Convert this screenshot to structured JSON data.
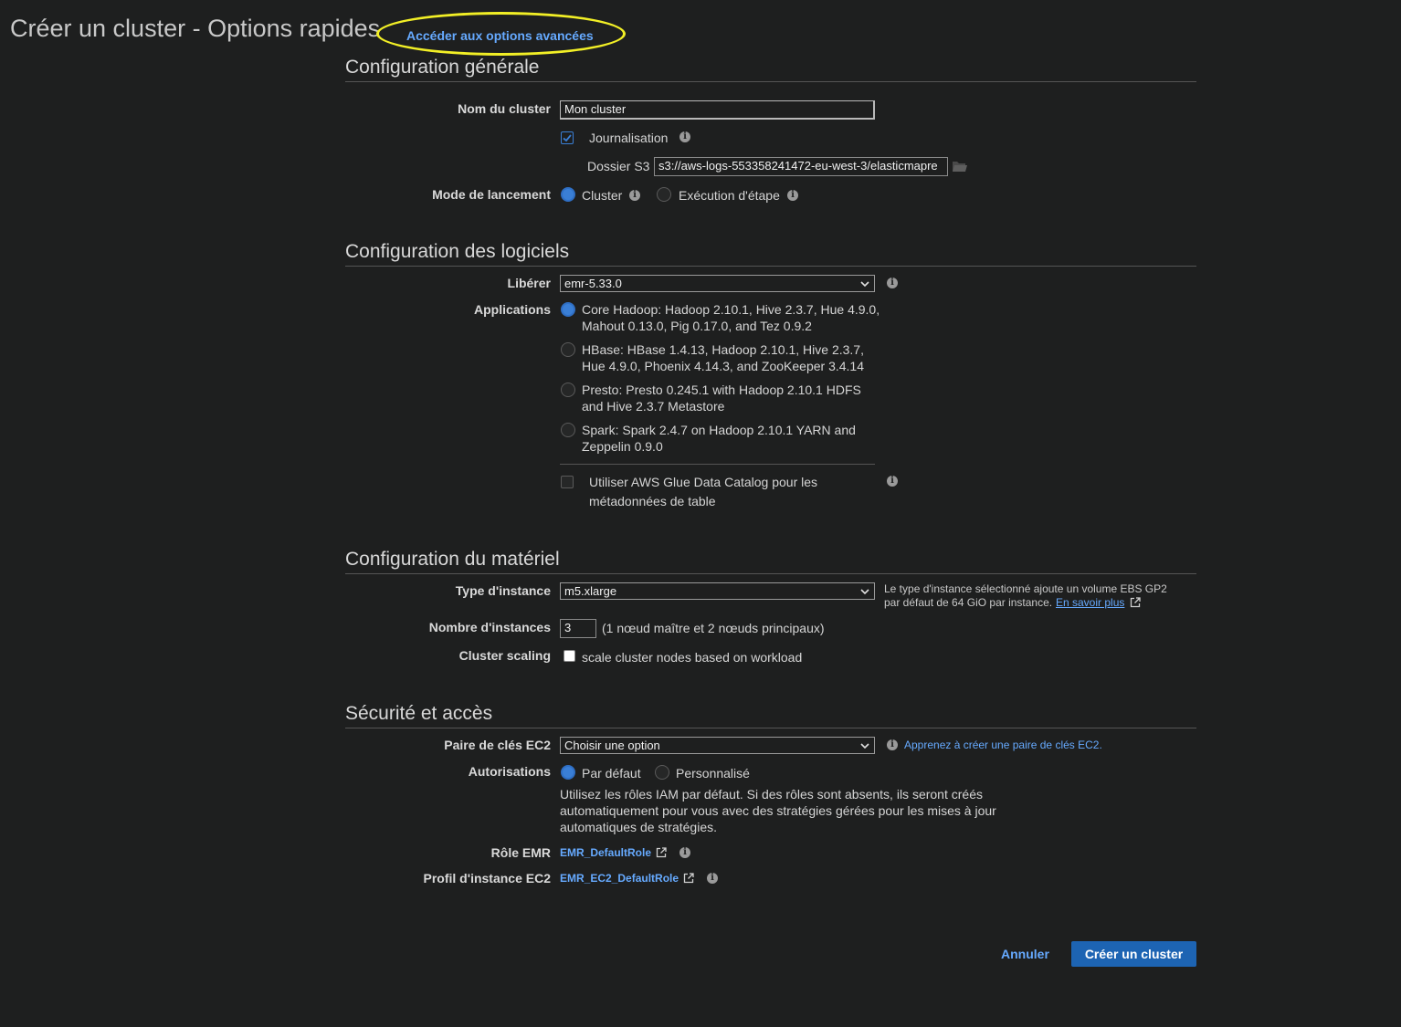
{
  "header": {
    "title": "Créer un cluster - Options rapides",
    "advanced_link": "Accéder aux options avancées"
  },
  "general": {
    "section_title": "Configuration générale",
    "cluster_name_label": "Nom du cluster",
    "cluster_name_value": "Mon cluster",
    "logging_label": "Journalisation",
    "logging_checked": true,
    "s3_folder_label": "Dossier S3",
    "s3_folder_value": "s3://aws-logs-553358241472-eu-west-3/elasticmapre",
    "launch_mode_label": "Mode de lancement",
    "launch_mode_options": [
      "Cluster",
      "Exécution d'étape"
    ],
    "launch_mode_selected": "Cluster"
  },
  "software": {
    "section_title": "Configuration des logiciels",
    "release_label": "Libérer",
    "release_value": "emr-5.33.0",
    "applications_label": "Applications",
    "applications": [
      "Core Hadoop: Hadoop 2.10.1, Hive 2.3.7, Hue 4.9.0, Mahout 0.13.0, Pig 0.17.0, and Tez 0.9.2",
      "HBase: HBase 1.4.13, Hadoop 2.10.1, Hive 2.3.7, Hue 4.9.0, Phoenix 4.14.3, and ZooKeeper 3.4.14",
      "Presto: Presto 0.245.1 with Hadoop 2.10.1 HDFS and Hive 2.3.7 Metastore",
      "Spark: Spark 2.4.7 on Hadoop 2.10.1 YARN and Zeppelin 0.9.0"
    ],
    "applications_selected": 0,
    "glue_label_line1": "Utiliser AWS Glue Data Catalog pour les",
    "glue_label_line2": "métadonnées de table",
    "glue_checked": false
  },
  "hardware": {
    "section_title": "Configuration du matériel",
    "instance_type_label": "Type d'instance",
    "instance_type_value": "m5.xlarge",
    "instance_note_line1": "Le type d'instance sélectionné ajoute un volume EBS GP2",
    "instance_note_line2": "par défaut de 64 GiO par instance.",
    "learn_more": "En savoir plus",
    "instance_count_label": "Nombre d'instances",
    "instance_count_value": "3",
    "instance_count_note": "(1 nœud maître et 2 nœuds principaux)",
    "scaling_label": "Cluster scaling",
    "scaling_option": "scale cluster nodes based on workload",
    "scaling_checked": false
  },
  "security": {
    "section_title": "Sécurité et accès",
    "keypair_label": "Paire de clés EC2",
    "keypair_value": "Choisir une option",
    "keypair_help": "Apprenez à créer une paire de clés EC2.",
    "permissions_label": "Autorisations",
    "permissions_options": [
      "Par défaut",
      "Personnalisé"
    ],
    "permissions_selected": "Par défaut",
    "permissions_desc_line1": "Utilisez les rôles IAM par défaut. Si des rôles sont absents, ils seront créés",
    "permissions_desc_line2": "automatiquement pour vous avec des stratégies gérées pour les mises à jour",
    "permissions_desc_line3": "automatiques de stratégies.",
    "emr_role_label": "Rôle EMR",
    "emr_role_value": "EMR_DefaultRole",
    "ec2_profile_label": "Profil d'instance EC2",
    "ec2_profile_value": "EMR_EC2_DefaultRole"
  },
  "footer": {
    "cancel": "Annuler",
    "create": "Créer un cluster"
  },
  "colors": {
    "background": "#1e1f1f",
    "link": "#66aaff",
    "primary_button": "#1d64b3",
    "highlight": "#f2ef26",
    "radio_selected": "#3a7fd6"
  },
  "icons": [
    "info-icon",
    "folder-icon",
    "external-link-icon",
    "chevron-down-icon",
    "checkmark-icon"
  ]
}
